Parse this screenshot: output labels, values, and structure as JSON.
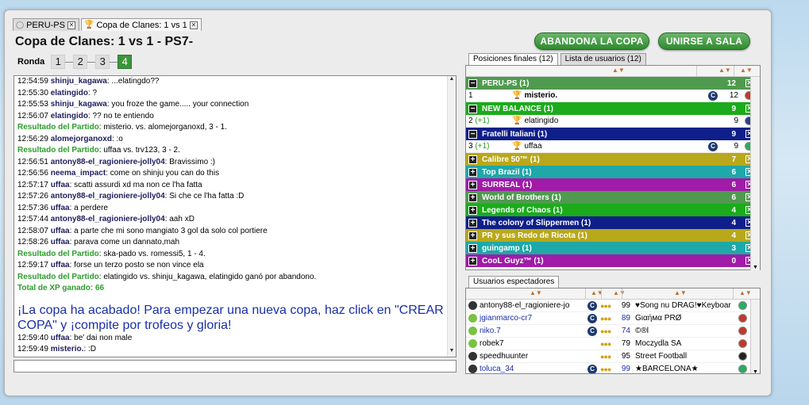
{
  "tabs": [
    {
      "label": "PERU-PS",
      "active": false
    },
    {
      "label": "Copa de Clanes: 1 vs  1",
      "active": true
    }
  ],
  "title": "Copa de Clanes: 1 vs  1   - PS7-",
  "buttons": {
    "leave": "ABANDONA LA COPA",
    "join": "UNIRSE A SALA"
  },
  "ronda": {
    "label": "Ronda",
    "rounds": [
      "1",
      "2",
      "3",
      "4"
    ],
    "current": "4"
  },
  "chat": [
    {
      "time": "12:54:59",
      "user": "shinju_kagawa",
      "text": ": ...elatingdo??"
    },
    {
      "time": "12:55:30",
      "user": "elatingido",
      "text": ": ?"
    },
    {
      "time": "12:55:53",
      "user": "shinju_kagawa",
      "text": ": you froze the game..... your connection"
    },
    {
      "time": "12:56:07",
      "user": "elatingido",
      "text": ": ?? no te entiendo"
    },
    {
      "time": "",
      "result": "Resultado del Partido",
      "text": ": misterio. vs. alomejorganoxd, 3 - 1."
    },
    {
      "time": "12:56:29",
      "user": "alomejorganoxd",
      "text": ": :o"
    },
    {
      "time": "",
      "result": "Resultado del Partido",
      "text": ": uffaa vs. trv123, 3 - 2."
    },
    {
      "time": "12:56:51",
      "user": "antony88-el_ragioniere-jolly04",
      "text": ": Bravissimo :)"
    },
    {
      "time": "12:56:56",
      "user": "neema_impact",
      "text": ": come on shinju you can do this"
    },
    {
      "time": "12:57:17",
      "user": "uffaa",
      "text": ": scatti assurdi xd ma non ce l'ha fatta"
    },
    {
      "time": "12:57:26",
      "user": "antony88-el_ragioniere-jolly04",
      "text": ": Si che ce l'ha fatta :D"
    },
    {
      "time": "12:57:36",
      "user": "uffaa",
      "text": ": a perdere"
    },
    {
      "time": "12:57:44",
      "user": "antony88-el_ragioniere-jolly04",
      "text": ": aah xD"
    },
    {
      "time": "12:58:07",
      "user": "uffaa",
      "text": ": a parte che mi sono mangiato 3 gol da solo col portiere"
    },
    {
      "time": "12:58:26",
      "user": "uffaa",
      "text": ": parava come un dannato,mah"
    },
    {
      "time": "",
      "result": "Resultado del Partido",
      "text": ": ska-pado vs. romessi5, 1 - 4."
    },
    {
      "time": "12:59:17",
      "user": "uffaa",
      "text": ": forse un terzo posto se non vince ela"
    },
    {
      "time": "",
      "result": "Resultado del Partido",
      "text": ": elatingido vs. shinju_kagawa, elatingido ganó por abandono."
    },
    {
      "time": "",
      "result": "Total de XP ganado: 66",
      "text": ""
    }
  ],
  "cup_end": "¡La copa ha acabado! Para empezar una nueva copa, haz click en \"CREAR COPA\" y ¡compite por trofeos y gloria!",
  "chat_after": [
    {
      "time": "12:59:40",
      "user": "uffaa",
      "text": ": be' dai non male"
    },
    {
      "time": "12:59:49",
      "user": "misterio.",
      "text": ": :D"
    }
  ],
  "standings_tabs": [
    "Posiciones finales (12)",
    "Lista de usuarios (12)"
  ],
  "standings": [
    {
      "name": "PERU-PS (1)",
      "points": "12",
      "color": "#4f9a4f",
      "expanded": true,
      "player": {
        "pos": "1",
        "gain": "",
        "name": "misterio.",
        "points": "12",
        "bold": true,
        "trophy": true,
        "badge": true,
        "flag": "#c0392b"
      }
    },
    {
      "name": "NEW BALANCE (1)",
      "points": "9",
      "color": "#1bab1b",
      "expanded": true,
      "player": {
        "pos": "2",
        "gain": "(+1)",
        "name": "elatingido",
        "points": "9",
        "bold": false,
        "trophy": true,
        "badge": false,
        "flag": "#2c3e90"
      }
    },
    {
      "name": "Fratelli Italiani (1)",
      "points": "9",
      "color": "#0f1f8a",
      "expanded": true,
      "player": {
        "pos": "3",
        "gain": "(+1)",
        "name": "uffaa",
        "points": "9",
        "bold": false,
        "trophy": true,
        "badge": true,
        "flag": "#27ae60"
      }
    },
    {
      "name": "Calibre 50™ (1)",
      "points": "7",
      "color": "#b8a81b",
      "expanded": false
    },
    {
      "name": "Top Brazil (1)",
      "points": "6",
      "color": "#1fa8a8",
      "expanded": false
    },
    {
      "name": "SURREAL (1)",
      "points": "6",
      "color": "#a01ba8",
      "expanded": false
    },
    {
      "name": "World of Brothers (1)",
      "points": "6",
      "color": "#4f9a4f",
      "expanded": false
    },
    {
      "name": "Legends of Chaos (1)",
      "points": "4",
      "color": "#1bab1b",
      "expanded": false
    },
    {
      "name": "The colony of Slippermen (1)",
      "points": "4",
      "color": "#0f1f8a",
      "expanded": false
    },
    {
      "name": "PR y sus Redo de Ricota (1)",
      "points": "4",
      "color": "#b8a81b",
      "expanded": false
    },
    {
      "name": "guingamp (1)",
      "points": "3",
      "color": "#1fa8a8",
      "expanded": false
    },
    {
      "name": "CooL Guyz™ (1)",
      "points": "0",
      "color": "#a01ba8",
      "expanded": false
    }
  ],
  "spectators_tab": "Usuarios espectadores",
  "spectators": [
    {
      "name": "antony88-el_ragioniere-jo",
      "blue": false,
      "ball": "#333",
      "badge": true,
      "level": "99",
      "team": "♥Song nu DRAG!♥Keyboar",
      "flag": "#27ae60"
    },
    {
      "name": "jgianmarco-cr7",
      "blue": true,
      "ball": "#7bc043",
      "badge": true,
      "level": "89",
      "team": "Gιαήмα PRØ",
      "flag": "#c0392b"
    },
    {
      "name": "niko.7",
      "blue": true,
      "ball": "#7bc043",
      "badge": true,
      "level": "74",
      "team": "©®l",
      "flag": "#c0392b"
    },
    {
      "name": "robek7",
      "blue": false,
      "ball": "#7bc043",
      "badge": false,
      "level": "79",
      "team": "Moczydla SA",
      "flag": "#c0392b"
    },
    {
      "name": "speedhuunter",
      "blue": false,
      "ball": "#333",
      "badge": false,
      "level": "95",
      "team": "Street Football",
      "flag": "#222"
    },
    {
      "name": "toluca_34",
      "blue": true,
      "ball": "#333",
      "badge": true,
      "level": "99",
      "team": "★BARCELONA★",
      "flag": "#27ae60"
    }
  ]
}
